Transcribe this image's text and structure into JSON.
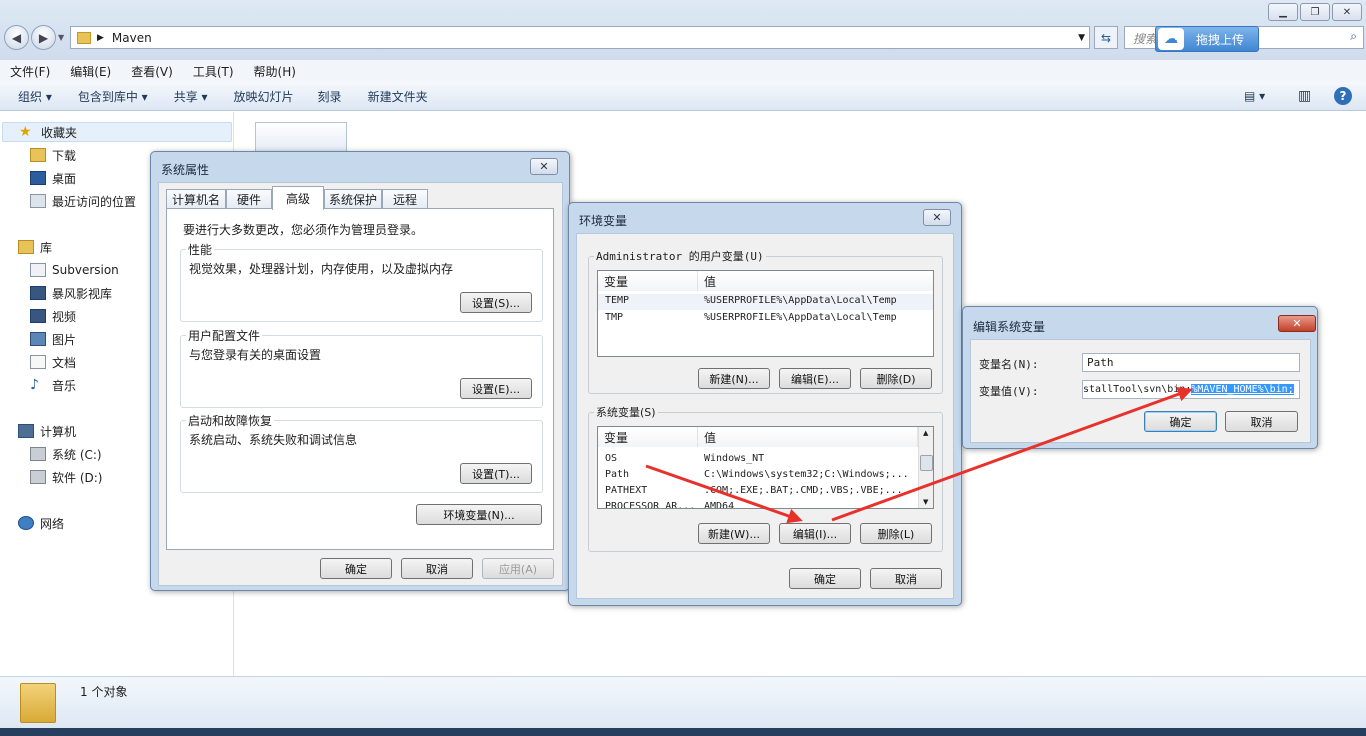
{
  "explorer": {
    "breadcrumb_current": "Maven",
    "search_placeholder": "搜索",
    "upload_button": "拖拽上传",
    "menu": [
      "文件(F)",
      "编辑(E)",
      "查看(V)",
      "工具(T)",
      "帮助(H)"
    ],
    "toolbar": [
      "组织 ▾",
      "包含到库中 ▾",
      "共享 ▾",
      "放映幻灯片",
      "刻录",
      "新建文件夹"
    ],
    "nav": {
      "favorites": "收藏夹",
      "downloads": "下载",
      "desktop": "桌面",
      "recent": "最近访问的位置",
      "libraries": "库",
      "subversion": "Subversion",
      "storm": "暴风影视库",
      "videos": "视频",
      "pictures": "图片",
      "documents": "文档",
      "music": "音乐",
      "computer": "计算机",
      "drive_c": "系统 (C:)",
      "drive_d": "软件 (D:)",
      "network": "网络"
    },
    "status_count": "1 个对象"
  },
  "sysprops": {
    "title": "系统属性",
    "tabs": [
      "计算机名",
      "硬件",
      "高级",
      "系统保护",
      "远程"
    ],
    "admin_note": "要进行大多数更改，您必须作为管理员登录。",
    "perf_label": "性能",
    "perf_desc": "视觉效果，处理器计划，内存使用，以及虚拟内存",
    "perf_btn": "设置(S)...",
    "profile_label": "用户配置文件",
    "profile_desc": "与您登录有关的桌面设置",
    "profile_btn": "设置(E)...",
    "startup_label": "启动和故障恢复",
    "startup_desc": "系统启动、系统失败和调试信息",
    "startup_btn": "设置(T)...",
    "env_btn": "环境变量(N)...",
    "ok": "确定",
    "cancel": "取消",
    "apply": "应用(A)"
  },
  "envvars": {
    "title": "环境变量",
    "user_group": "Administrator 的用户变量(U)",
    "col_var": "变量",
    "col_val": "值",
    "user_rows": [
      {
        "name": "TEMP",
        "value": "%USERPROFILE%\\AppData\\Local\\Temp"
      },
      {
        "name": "TMP",
        "value": "%USERPROFILE%\\AppData\\Local\\Temp"
      }
    ],
    "user_new": "新建(N)...",
    "user_edit": "编辑(E)...",
    "user_delete": "删除(D)",
    "sys_group": "系统变量(S)",
    "sys_rows": [
      {
        "name": "OS",
        "value": "Windows_NT"
      },
      {
        "name": "Path",
        "value": "C:\\Windows\\system32;C:\\Windows;..."
      },
      {
        "name": "PATHEXT",
        "value": ".COM;.EXE;.BAT;.CMD;.VBS;.VBE;..."
      },
      {
        "name": "PROCESSOR_AR...",
        "value": "AMD64"
      }
    ],
    "sys_new": "新建(W)...",
    "sys_edit": "编辑(I)...",
    "sys_delete": "删除(L)",
    "ok": "确定",
    "cancel": "取消"
  },
  "editvar": {
    "title": "编辑系统变量",
    "name_label": "变量名(N):",
    "name_value": "Path",
    "value_label": "变量值(V):",
    "value_plain": "stallTool\\svn\\bin;",
    "value_selected": "%MAVEN_HOME%\\bin;",
    "ok": "确定",
    "cancel": "取消"
  },
  "colors": {
    "annotation_arrow": "#e8312a",
    "selection": "#3399ff"
  }
}
